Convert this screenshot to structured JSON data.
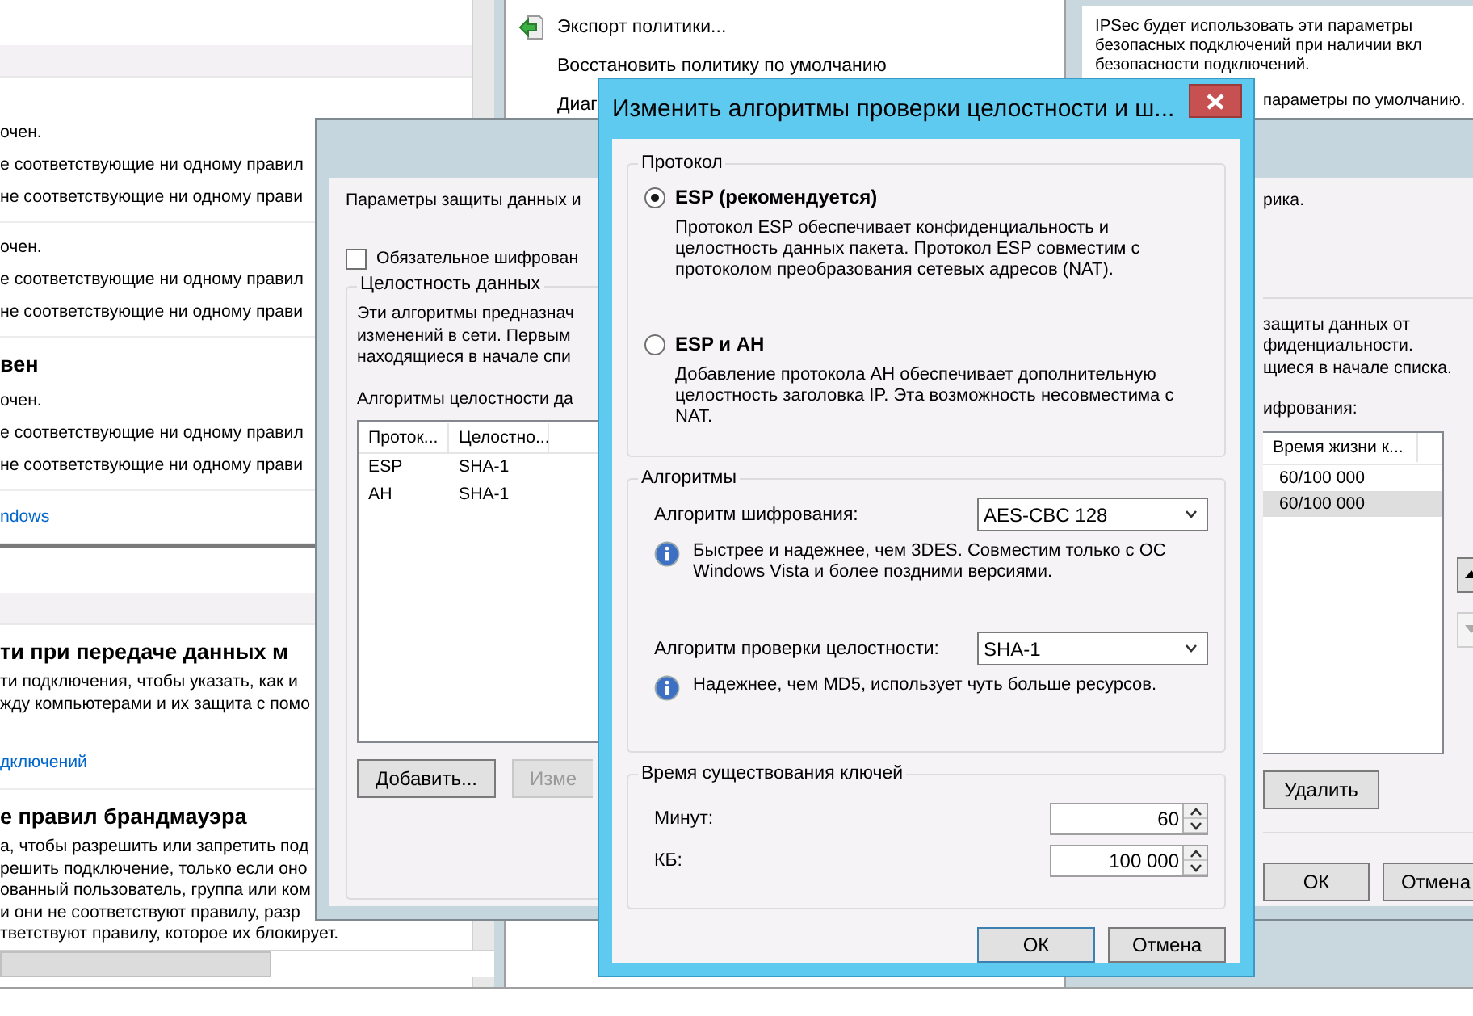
{
  "content_panels": [
    {
      "sections": [
        {
          "items": [
            {
              "kind": "text",
              "text": "очен."
            },
            {
              "kind": "text",
              "text": "е соответствующие ни одному правил"
            },
            {
              "kind": "text",
              "text": "не соответствующие ни одному прави"
            }
          ]
        },
        {
          "items": [
            {
              "kind": "text",
              "text": "очен."
            },
            {
              "kind": "text",
              "text": "е соответствующие ни одному правил"
            },
            {
              "kind": "text",
              "text": "не соответствующие ни одному прави"
            }
          ]
        },
        {
          "items": [
            {
              "kind": "heading",
              "text": "вен"
            },
            {
              "kind": "text",
              "text": "очен."
            },
            {
              "kind": "text",
              "text": "е соответствующие ни одному правил"
            },
            {
              "kind": "text",
              "text": "не соответствующие ни одному прави"
            }
          ]
        },
        {
          "items": [
            {
              "kind": "link",
              "text": "ndows"
            }
          ]
        }
      ]
    },
    {
      "sections": [
        {
          "items": [
            {
              "kind": "heading",
              "text": "ти при передаче данных м"
            },
            {
              "kind": "text",
              "text": "ти подключения, чтобы указать, как и"
            },
            {
              "kind": "text",
              "text": "жду компьютерами и их защита с помо"
            },
            {
              "kind": "gap"
            },
            {
              "kind": "link",
              "text": "дключений"
            }
          ]
        },
        {
          "items": [
            {
              "kind": "heading",
              "text": "е правил брандмауэра"
            },
            {
              "kind": "text",
              "text": "а, чтобы разрешить или запретить под"
            },
            {
              "kind": "text",
              "text": "решить подключение, только если оно"
            },
            {
              "kind": "text",
              "text": "ованный пользователь, группа или ком"
            },
            {
              "kind": "text",
              "text": "и они не соответствуют правилу, разр"
            },
            {
              "kind": "text",
              "text": "тветствуют правилу, которое их блокирует."
            }
          ]
        }
      ]
    }
  ],
  "actions": [
    {
      "kind": "export",
      "label": "Экспорт политики..."
    },
    {
      "kind": "plain",
      "label": "Восстановить политику по умолчанию"
    },
    {
      "kind": "plain",
      "label": "Диаг"
    }
  ],
  "ipsec_window": {
    "lines": [
      "IPSec будет использовать эти параметры",
      "безопасных подключений при наличии вкл",
      "безопасности подключений.",
      "параметры по умолчанию."
    ]
  },
  "protection_dialog": {
    "intro_left": "Параметры защиты данных и",
    "intro_right": "рика.",
    "encryption_checkbox": {
      "label": "Обязательное шифрован",
      "checked": false
    },
    "integrity_group": {
      "title": "Целостность данных",
      "description": [
        "Эти алгоритмы предназнач",
        "изменений в сети. Первым",
        "находящиеся в начале спи"
      ],
      "list_label": "Алгоритмы целостности да",
      "columns": [
        "Проток...",
        "Целостно..."
      ],
      "rows": [
        [
          "ESP",
          "SHA-1"
        ],
        [
          "AH",
          "SHA-1"
        ]
      ],
      "buttons": [
        {
          "label": "Добавить...",
          "disabled": false
        },
        {
          "label": "Изме",
          "disabled": true
        }
      ]
    },
    "encryption_group": {
      "description": [
        "защиты данных от",
        "фиденциальности.",
        "щиеся в начале списка."
      ],
      "list_label": "ифрования:",
      "column": "Время жизни к...",
      "rows": [
        {
          "value": "60/100 000",
          "selected": false
        },
        {
          "value": "60/100 000",
          "selected": true
        }
      ],
      "move_buttons": [
        {
          "kind": "up",
          "disabled": false
        },
        {
          "kind": "down",
          "disabled": true
        }
      ],
      "remove_button": "Удалить"
    },
    "buttons": [
      "ОК",
      "Отмена"
    ]
  },
  "front_dialog": {
    "title": "Изменить алгоритмы проверки целостности и ш...",
    "protocol_group": {
      "title": "Протокол",
      "options": [
        {
          "label": "ESP (рекомендуется)",
          "selected": true,
          "description": "Протокол ESP обеспечивает конфиденциальность и целостность данных пакета. Протокол ESP совместим с протоколом преобразования сетевых адресов (NAT)."
        },
        {
          "label": "ESP и AH",
          "selected": false,
          "description": "Добавление протокола AH обеспечивает дополнительную целостность заголовка IP. Эта возможность несовместима с NAT."
        }
      ]
    },
    "algorithms_group": {
      "title": "Алгоритмы",
      "fields": [
        {
          "label": "Алгоритм шифрования:",
          "value": "AES-CBC 128",
          "info": "Быстрее и надежнее, чем 3DES. Совместим только с ОС Windows Vista и более поздними версиями."
        },
        {
          "label": "Алгоритм проверки целостности:",
          "value": "SHA-1",
          "info": "Надежнее, чем MD5, использует чуть больше ресурсов."
        }
      ]
    },
    "key_lifetime_group": {
      "title": "Время существования ключей",
      "fields": [
        {
          "label": "Минут:",
          "value": "60"
        },
        {
          "label": "КБ:",
          "value": "100 000"
        }
      ]
    },
    "buttons": [
      {
        "label": "ОК",
        "default": true
      },
      {
        "label": "Отмена",
        "default": false
      }
    ]
  }
}
